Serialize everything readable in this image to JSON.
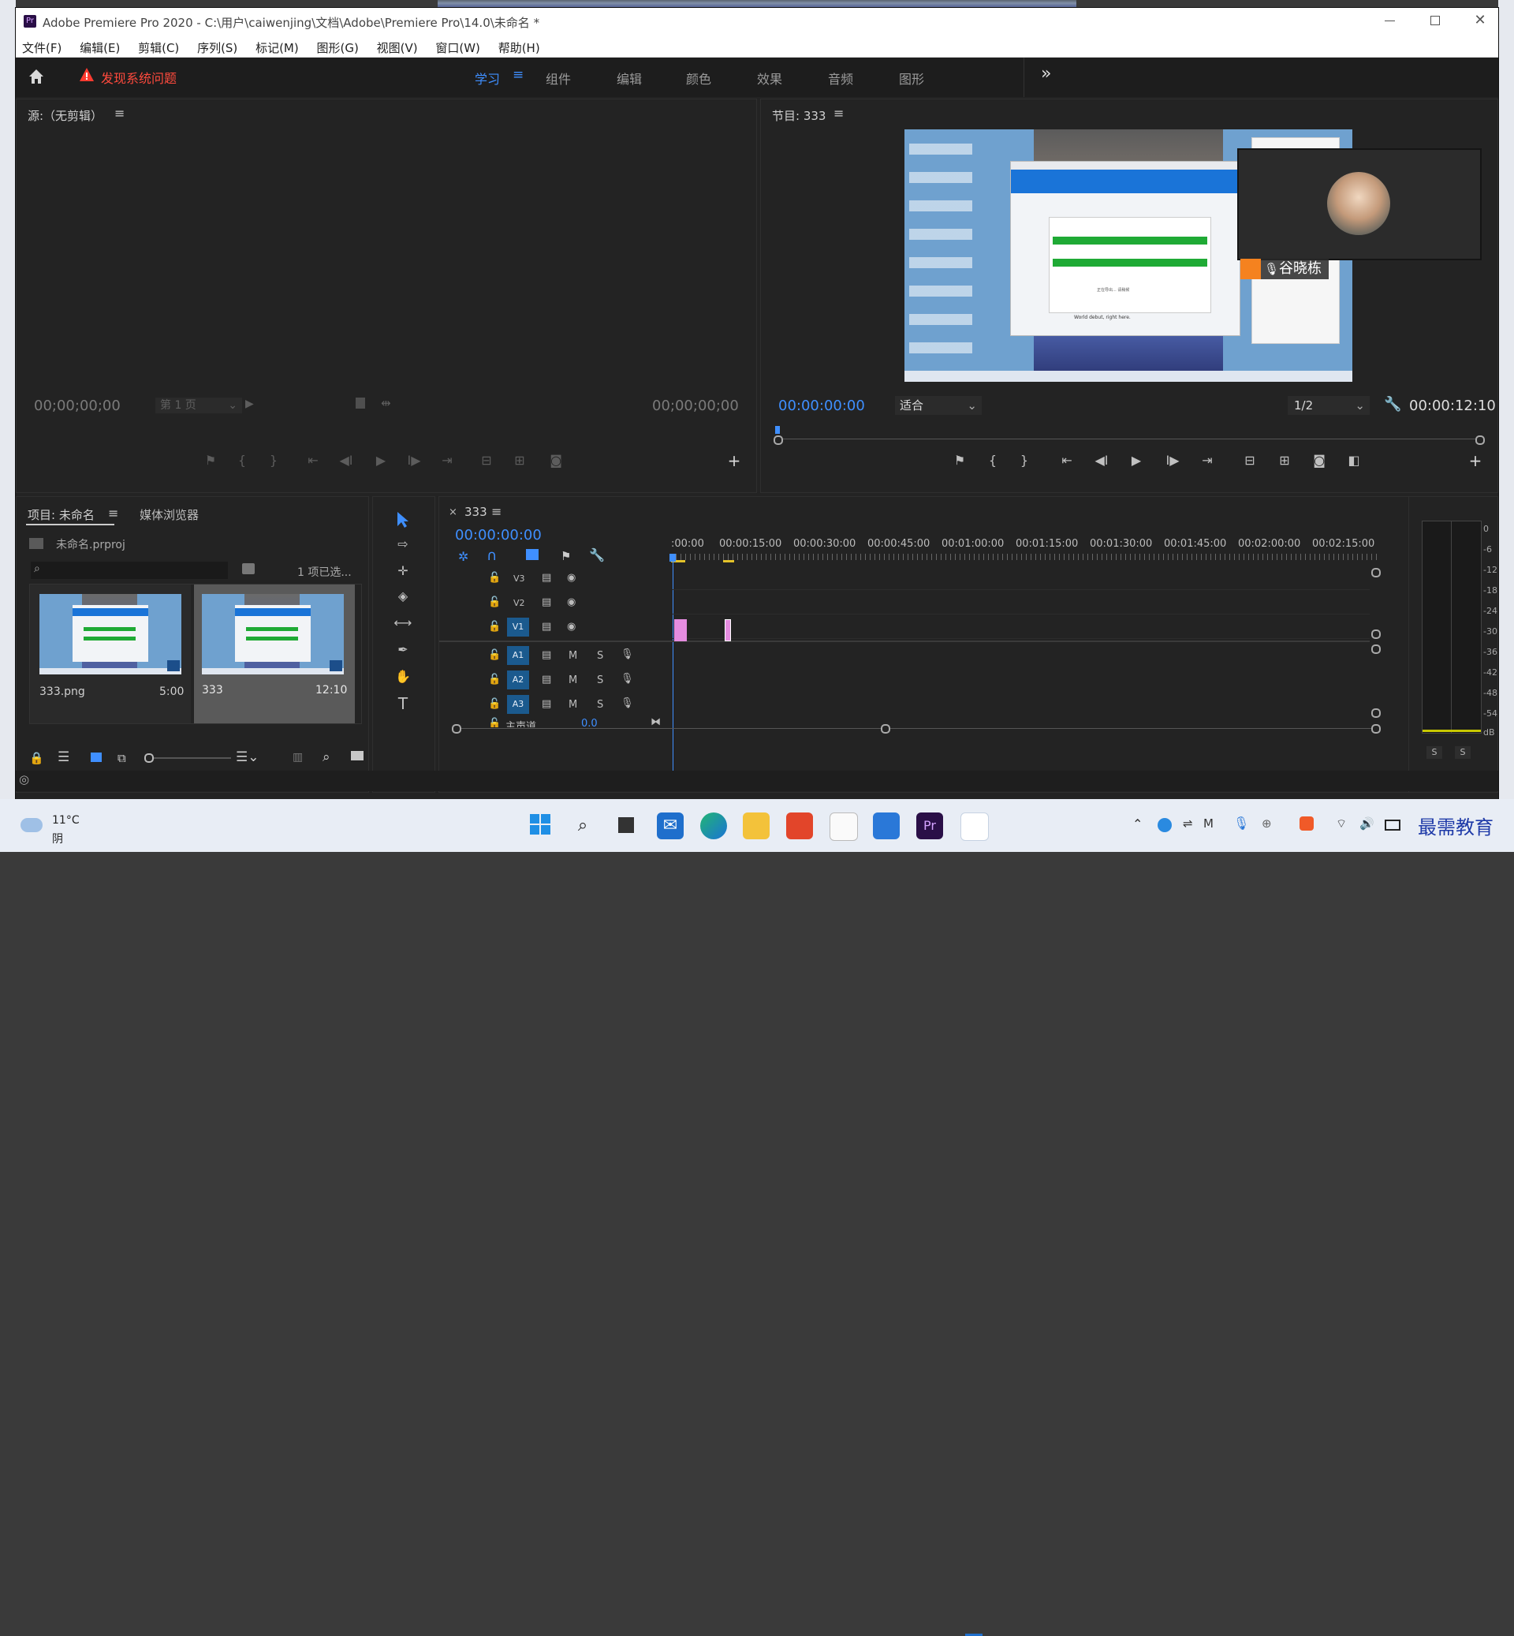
{
  "window": {
    "title": "Adobe Premiere Pro 2020 - C:\\用户\\caiwenjing\\文档\\Adobe\\Premiere Pro\\14.0\\未命名 *",
    "app_badge": "Pr"
  },
  "menu": [
    "文件(F)",
    "编辑(E)",
    "剪辑(C)",
    "序列(S)",
    "标记(M)",
    "图形(G)",
    "视图(V)",
    "窗口(W)",
    "帮助(H)"
  ],
  "workspace": {
    "warning": "发现系统问题",
    "tabs": [
      "学习",
      "组件",
      "编辑",
      "颜色",
      "效果",
      "音频",
      "图形"
    ],
    "active_tab": "学习",
    "more": "»"
  },
  "source_monitor": {
    "title": "源:（无剪辑）",
    "timecode_left": "00;00;00;00",
    "page_select": "第 1 页",
    "timecode_right": "00;00;00;00"
  },
  "program_monitor": {
    "title": "节目: 333",
    "timecode": "00:00:00:00",
    "fit": "适合",
    "resolution": "1/2",
    "duration": "00:00:12:10",
    "overlay_name": "谷晓栋",
    "preview_text_1": "正在导出... 请稍候",
    "preview_text_2": "World debut, right here."
  },
  "project_panel": {
    "title": "项目: 未命名",
    "tab2": "媒体浏览器",
    "file": "未命名.prproj",
    "selection": "1 项已选...",
    "items": [
      {
        "name": "333.png",
        "duration": "5:00"
      },
      {
        "name": "333",
        "duration": "12:10"
      }
    ]
  },
  "timeline": {
    "sequence": "333",
    "timecode": "00:00:00:00",
    "ruler": [
      ":00:00",
      "00:00:15:00",
      "00:00:30:00",
      "00:00:45:00",
      "00:01:00:00",
      "00:01:15:00",
      "00:01:30:00",
      "00:01:45:00",
      "00:02:00:00",
      "00:02:15:00"
    ],
    "video_tracks": [
      "V3",
      "V2",
      "V1"
    ],
    "audio_tracks": [
      "A1",
      "A2",
      "A3"
    ],
    "master": "主声道",
    "master_value": "0.0",
    "m_label": "M",
    "s_label": "S"
  },
  "audio_meter": {
    "scale": [
      "0",
      "-6",
      "-12",
      "-18",
      "-24",
      "-30",
      "-36",
      "-42",
      "-48",
      "-54",
      "dB"
    ],
    "solo_left": "S",
    "solo_right": "S"
  },
  "taskbar": {
    "temp": "11°C",
    "weather": "阴",
    "brand": "最需教育"
  },
  "colors": {
    "accent_blue": "#3f8fff",
    "warning_red": "#ff3b30",
    "track_blue": "#1b5a8e",
    "clip_pink": "#e58ce0"
  }
}
